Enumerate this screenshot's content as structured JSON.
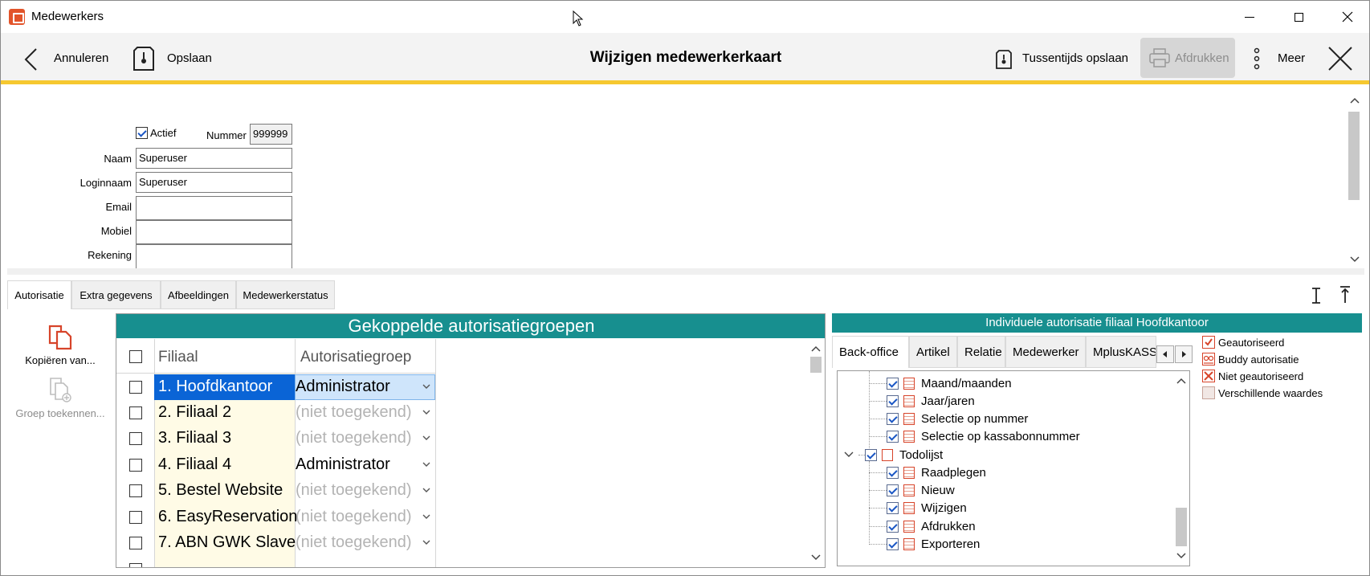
{
  "window": {
    "title": "Medewerkers"
  },
  "toolbar": {
    "cancel_label": "Annuleren",
    "save_label": "Opslaan",
    "title": "Wijzigen medewerkerkaart",
    "interim_save_label": "Tussentijds opslaan",
    "print_label": "Afdrukken",
    "more_label": "Meer"
  },
  "form": {
    "active_label": "Actief",
    "active_checked": true,
    "number_label": "Nummer",
    "number_value": "999999",
    "name_label": "Naam",
    "name_value": "Superuser",
    "login_label": "Loginnaam",
    "login_value": "Superuser",
    "email_label": "Email",
    "email_value": "",
    "mobile_label": "Mobiel",
    "mobile_value": "",
    "account_label": "Rekening",
    "account_value": ""
  },
  "tabs": [
    "Autorisatie",
    "Extra gegevens",
    "Afbeeldingen",
    "Medewerkerstatus"
  ],
  "side": {
    "copy_label": "Kopiëren van...",
    "assign_label": "Groep toekennen..."
  },
  "grid": {
    "title": "Gekoppelde autorisatiegroepen",
    "col_filiaal": "Filiaal",
    "col_group": "Autorisatiegroep",
    "rows": [
      {
        "filiaal": "1. Hoofdkantoor",
        "group": "Administrator",
        "assigned": true,
        "selected": true
      },
      {
        "filiaal": "2. Filiaal 2",
        "group": "(niet toegekend)",
        "assigned": false
      },
      {
        "filiaal": "3. Filiaal 3",
        "group": "(niet toegekend)",
        "assigned": false
      },
      {
        "filiaal": "4. Filiaal 4",
        "group": "Administrator",
        "assigned": true
      },
      {
        "filiaal": "5. Bestel Website",
        "group": "(niet toegekend)",
        "assigned": false
      },
      {
        "filiaal": "6. EasyReservation",
        "group": "(niet toegekend)",
        "assigned": false
      },
      {
        "filiaal": "7. ABN GWK Slave",
        "group": "(niet toegekend)",
        "assigned": false
      }
    ]
  },
  "individual": {
    "title": "Individuele autorisatie filiaal Hoofdkantoor",
    "tabs": [
      "Back-office",
      "Artikel",
      "Relatie",
      "Medewerker",
      "MplusKASSA"
    ],
    "tree": [
      {
        "label": "Maand/maanden",
        "level": 2
      },
      {
        "label": "Jaar/jaren",
        "level": 2
      },
      {
        "label": "Selectie op nummer",
        "level": 2
      },
      {
        "label": "Selectie op kassabonnummer",
        "level": 2
      },
      {
        "label": "Todolijst",
        "level": 1
      },
      {
        "label": "Raadplegen",
        "level": 2
      },
      {
        "label": "Nieuw",
        "level": 2
      },
      {
        "label": "Wijzigen",
        "level": 2
      },
      {
        "label": "Afdrukken",
        "level": 2
      },
      {
        "label": "Exporteren",
        "level": 2
      }
    ]
  },
  "legend": {
    "authorized": "Geautoriseerd",
    "buddy": "Buddy autorisatie",
    "not_authorized": "Niet geautoriseerd",
    "different": "Verschillende waardes"
  },
  "colors": {
    "accent": "#178f8f",
    "highlight": "#f6c830",
    "icon": "#d7442a",
    "selection": "#0a64d6"
  }
}
